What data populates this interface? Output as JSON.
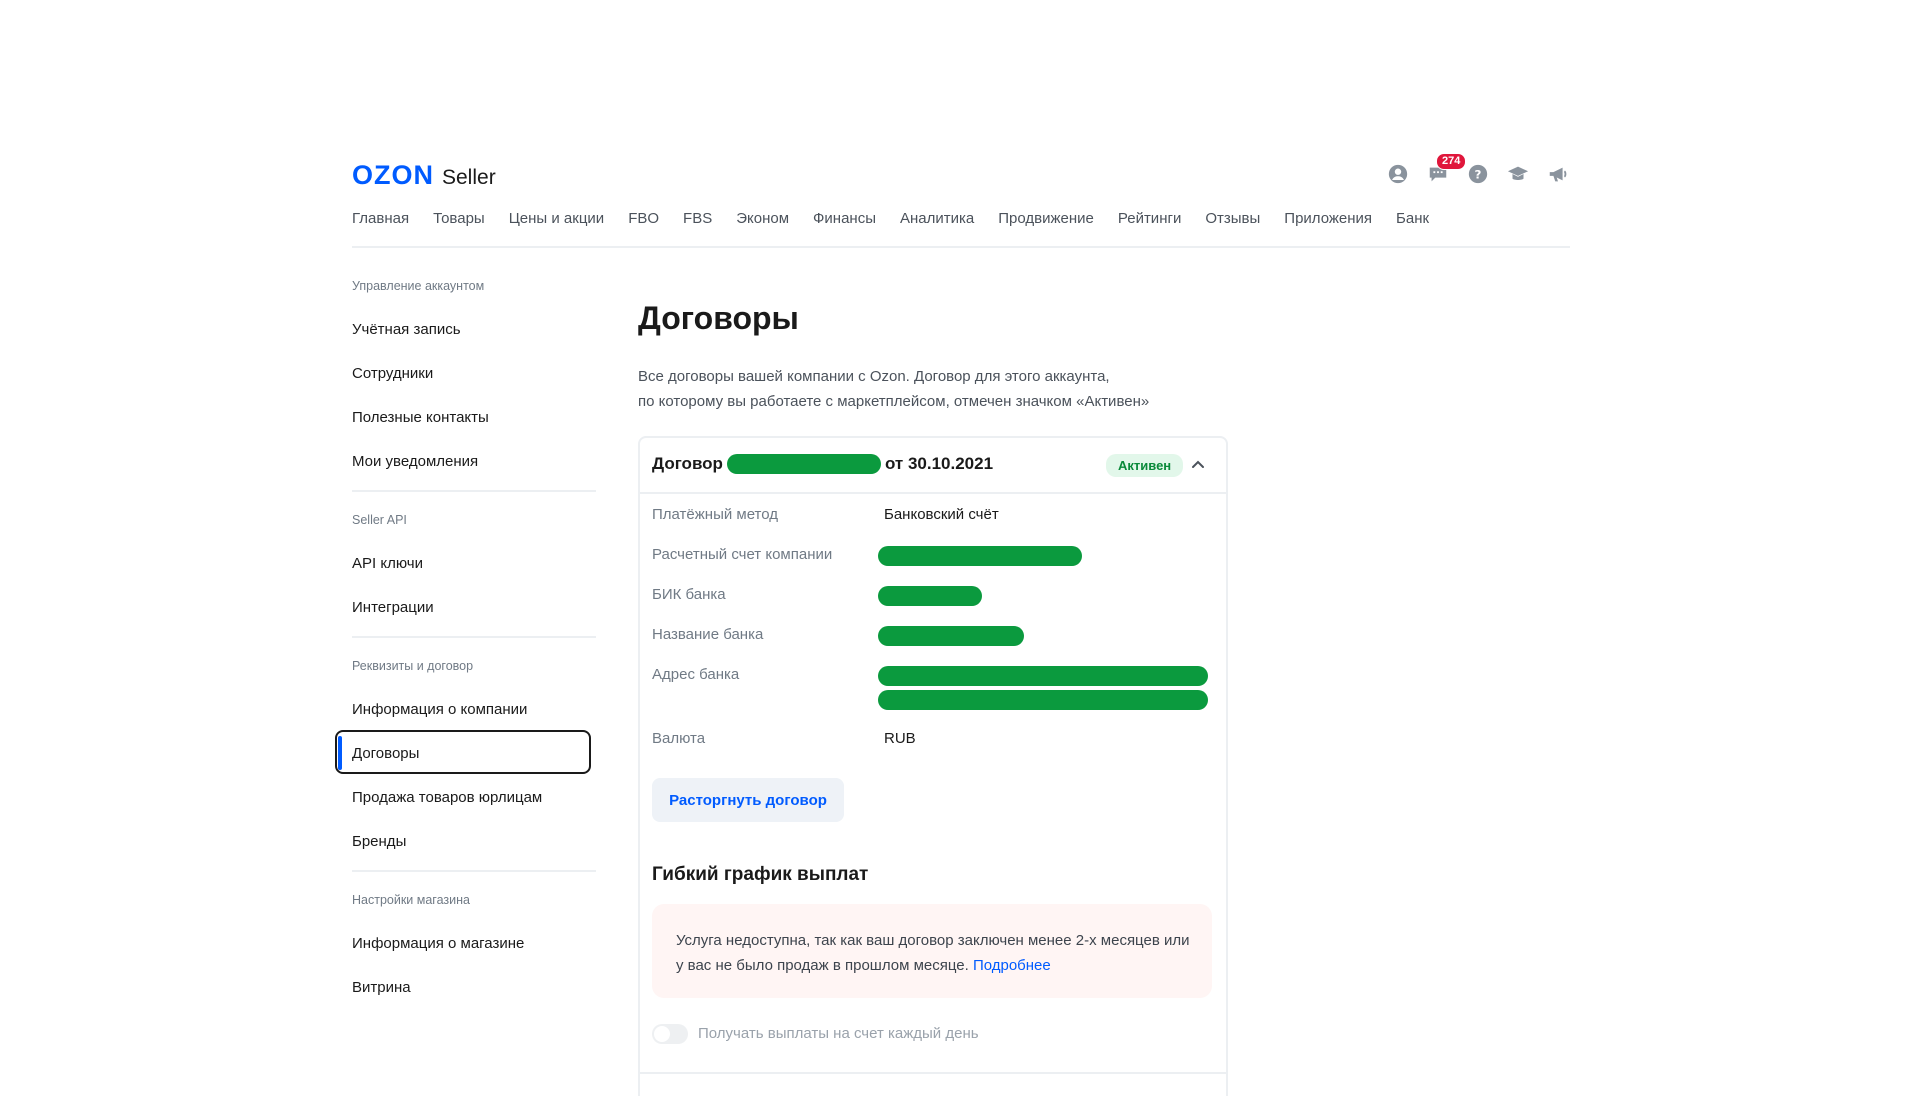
{
  "header": {
    "logo_brand": "OZON",
    "logo_product": "Seller",
    "notifications_count": "274",
    "icons": [
      "user-icon",
      "chat-icon",
      "help-icon",
      "graduation-cap-icon",
      "megaphone-icon"
    ]
  },
  "nav": [
    "Главная",
    "Товары",
    "Цены и акции",
    "FBO",
    "FBS",
    "Эконом",
    "Финансы",
    "Аналитика",
    "Продвижение",
    "Рейтинги",
    "Отзывы",
    "Приложения",
    "Банк"
  ],
  "sidebar": {
    "sections": [
      {
        "title": "Управление аккаунтом",
        "items": [
          "Учётная запись",
          "Сотрудники",
          "Полезные контакты",
          "Мои уведомления"
        ]
      },
      {
        "title": "Seller API",
        "items": [
          "API ключи",
          "Интеграции"
        ]
      },
      {
        "title": "Реквизиты и договор",
        "items": [
          "Информация о компании",
          "Договоры",
          "Продажа товаров юрлицам",
          "Бренды"
        ]
      },
      {
        "title": "Настройки магазина",
        "items": [
          "Информация о магазине",
          "Витрина"
        ]
      }
    ],
    "active_item": "Договоры"
  },
  "main": {
    "title": "Договоры",
    "description_line1": "Все договоры вашей компании с Ozon. Договор для этого аккаунта,",
    "description_line2": "по которому вы работаете с маркетплейсом, отмечен значком «Активен»",
    "contract": {
      "title_prefix": "Договор",
      "title_date": "от 30.10.2021",
      "status": "Активен",
      "payment_method_label": "Платёжный метод",
      "payment_method_value": "Банковский счёт",
      "account_label": "Расчетный счет компании",
      "bik_label": "БИК банка",
      "bank_name_label": "Название банка",
      "bank_address_label": "Адрес банка",
      "currency_label": "Валюта",
      "currency_value": "RUB",
      "terminate_button": "Расторгнуть договор",
      "redaction_color": "#0b9a3e"
    },
    "flex_payments": {
      "title": "Гибкий график выплат",
      "notice_text": "Услуга недоступна, так как ваш договор заключен менее 2-х месяцев или у вас не было продаж в прошлом месяце.",
      "notice_link": "Подробнее",
      "toggle_label": "Получать выплаты на счет каждый день"
    }
  },
  "colors": {
    "brand": "#005bff",
    "active_status_bg": "#e2f7ea",
    "active_status_text": "#0a8a3a",
    "badge": "#e0163b",
    "notice_bg": "#fff5f4"
  }
}
